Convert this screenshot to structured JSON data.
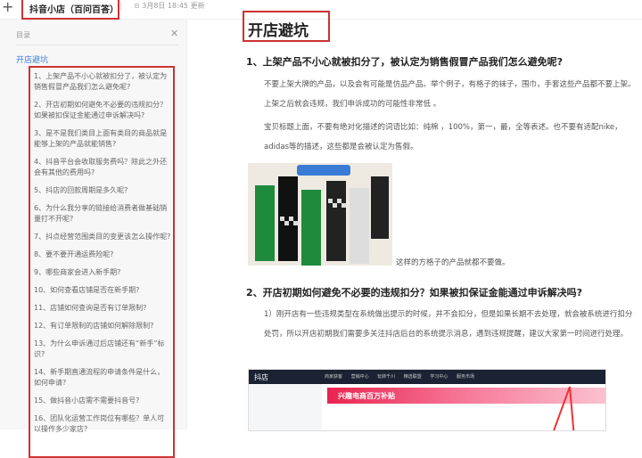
{
  "topbar": {
    "doc_tab": "抖音小店（百问百答）",
    "updated": "⊙ 3月8日 18:45 更新"
  },
  "toc": {
    "heading": "目录",
    "root": "开店避坑",
    "items": [
      "1、上架产品不小心就被扣分了，被认定为销售假冒产品我们怎么避免呢?",
      "2、开店初期如何避免不必要的违规扣分？如果被扣保证金能通过申诉解决吗?",
      "3、是不是我们类目上面有类目的商品就是能够上架的产品就能销售?",
      "4、抖音平台会收取服务费吗？除此之外还会有其他的费用吗?",
      "5、抖店的回款周期是多久呢?",
      "6、为什么我分享的链接给消费者做基础销量打不开呢?",
      "7、抖点经营范围类目的变更该怎么操作呢?",
      "8、要不要开通运费险呢?",
      "9、哪些商家会进入新手期?",
      "10、如何查看店铺是否在新手期?",
      "11、店铺如何查询是否有订单限制?",
      "12、有订单限制的店铺如何解除限制?",
      "13、为什么申诉通过后店铺还有“新手”标识?",
      "14、新手期直通流程的申请条件是什么，如何申请?",
      "15、做抖音小店需不需要抖音号?",
      "16、团队化运营工作岗位有哪些？单人可以操作多少家店?"
    ]
  },
  "article": {
    "title": "开店避坑",
    "h1": "1、上架产品不小心就被扣分了，被认定为销售假冒产品我们怎么避免呢?",
    "p1": "不要上架大牌的产品，以及会有可能是仿品产品。举个例子，有格子的袜子，围巾，手套这些产品都不要上架。上架之后就会违规，我们申诉成功的可能性非常低 。",
    "p2": "宝贝标题上面，不要有绝对化描述的词语比如：纯棉 ，100%，第一，最，全等表述。也不要有适配nike，adidas等的描述，这些都是会被认定为售假。",
    "caption": "这样的方格子的产品就都不要做。",
    "h2": "2、开店初期如何避免不必要的违规扣分？如果被扣保证金能通过申诉解决吗?",
    "p3": "1）刚开店有一些违规类型在系统做出提示的时候，并不会扣分，但是如果长期不去处理，就会被系统进行扣分处罚，所以开店初期我们需要多关注抖店后台的系统提示消息，遇到违规提醒，建议大家第一时间进行处理。",
    "shot": {
      "logo": "抖店",
      "menu": "商家获客 营销中心 玩转千川 精选联盟 学习中心 服务市场",
      "banner": "兴趣电商百万补贴"
    }
  }
}
